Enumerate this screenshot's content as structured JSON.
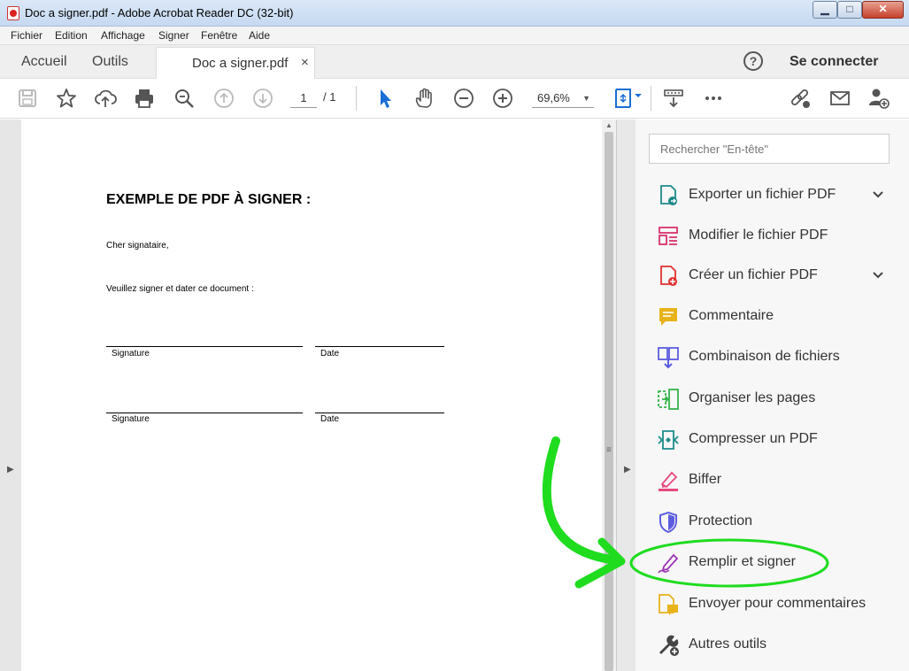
{
  "window": {
    "title": "Doc a signer.pdf - Adobe Acrobat Reader DC (32-bit)",
    "controls": {
      "minimize": "▁",
      "maximize": "□",
      "close": "✕"
    }
  },
  "menu": [
    "Fichier",
    "Edition",
    "Affichage",
    "Signer",
    "Fenêtre",
    "Aide"
  ],
  "tabs": {
    "home": "Accueil",
    "tools": "Outils",
    "document": "Doc a signer.pdf",
    "close_glyph": "×",
    "help_glyph": "?",
    "sign_in": "Se connecter"
  },
  "toolbar": {
    "page_current": "1",
    "page_total": "/ 1",
    "zoom": "69,6%",
    "zoom_caret": "▼"
  },
  "document": {
    "title": "EXEMPLE DE PDF À SIGNER :",
    "greeting": "Cher signataire,",
    "instruction": "Veuillez signer et dater ce document :",
    "signature_label": "Signature",
    "date_label": "Date"
  },
  "panel": {
    "search_placeholder": "Rechercher \"En-tête\"",
    "tools": [
      {
        "label": "Exporter un fichier PDF",
        "icon": "export-pdf-icon",
        "color": "#1d8a8a",
        "has_chevron": true
      },
      {
        "label": "Modifier le fichier PDF",
        "icon": "edit-pdf-icon",
        "color": "#d6336c",
        "has_chevron": false
      },
      {
        "label": "Créer un fichier PDF",
        "icon": "create-pdf-icon",
        "color": "#e03131",
        "has_chevron": true
      },
      {
        "label": "Commentaire",
        "icon": "comment-icon",
        "color": "#e8b21b",
        "has_chevron": false
      },
      {
        "label": "Combinaison de fichiers",
        "icon": "combine-files-icon",
        "color": "#5c5ce0",
        "has_chevron": false
      },
      {
        "label": "Organiser les pages",
        "icon": "organize-pages-icon",
        "color": "#37b24d",
        "has_chevron": false
      },
      {
        "label": "Compresser un PDF",
        "icon": "compress-pdf-icon",
        "color": "#1d8a8a",
        "has_chevron": false
      },
      {
        "label": "Biffer",
        "icon": "redact-icon",
        "color": "#e64980",
        "has_chevron": false
      },
      {
        "label": "Protection",
        "icon": "protection-icon",
        "color": "#5c5ce0",
        "has_chevron": false
      },
      {
        "label": "Remplir et signer",
        "icon": "fill-sign-icon",
        "color": "#9c36b5",
        "has_chevron": false
      },
      {
        "label": "Envoyer pour commentaires",
        "icon": "send-comments-icon",
        "color": "#e8b21b",
        "has_chevron": false
      },
      {
        "label": "Autres outils",
        "icon": "more-tools-icon",
        "color": "#444444",
        "has_chevron": false
      }
    ]
  },
  "annotation": {
    "color": "#1fdc1f",
    "highlighted_tool": "Remplir et signer"
  }
}
